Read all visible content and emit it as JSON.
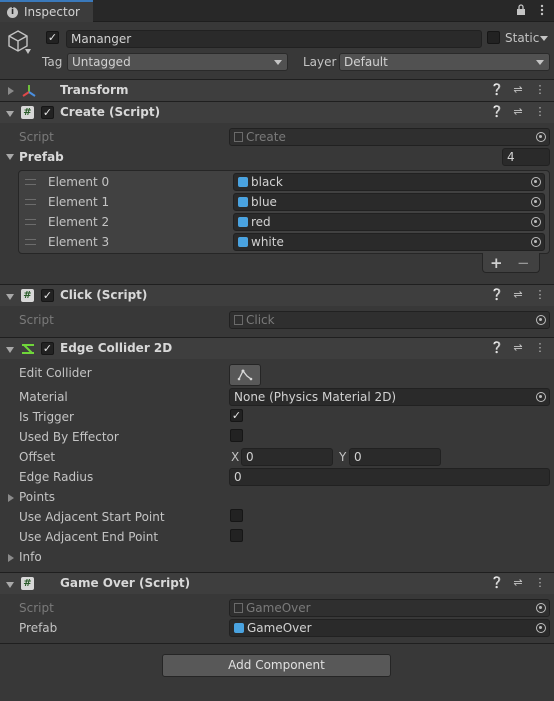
{
  "window": {
    "tab_label": "Inspector"
  },
  "gameobject": {
    "name": "Mananger",
    "static_label": "Static",
    "tag_label": "Tag",
    "tag_value": "Untagged",
    "layer_label": "Layer",
    "layer_value": "Default"
  },
  "components": {
    "transform": {
      "title": "Transform"
    },
    "create": {
      "title": "Create (Script)",
      "script_label": "Script",
      "script_value": "Create",
      "prefab_label": "Prefab",
      "prefab_size": "4",
      "elements": [
        {
          "label": "Element 0",
          "value": "black"
        },
        {
          "label": "Element 1",
          "value": "blue"
        },
        {
          "label": "Element 2",
          "value": "red"
        },
        {
          "label": "Element 3",
          "value": "white"
        }
      ],
      "add_symbol": "+",
      "remove_symbol": "−"
    },
    "click": {
      "title": "Click (Script)",
      "script_label": "Script",
      "script_value": "Click"
    },
    "edge": {
      "title": "Edge Collider 2D",
      "edit_collider_label": "Edit Collider",
      "material_label": "Material",
      "material_value": "None (Physics Material 2D)",
      "is_trigger_label": "Is Trigger",
      "used_by_effector_label": "Used By Effector",
      "offset_label": "Offset",
      "offset_x_label": "X",
      "offset_x": "0",
      "offset_y_label": "Y",
      "offset_y": "0",
      "edge_radius_label": "Edge Radius",
      "edge_radius": "0",
      "points_label": "Points",
      "adj_start_label": "Use Adjacent Start Point",
      "adj_end_label": "Use Adjacent End Point",
      "info_label": "Info"
    },
    "gameover": {
      "title": "Game Over (Script)",
      "script_label": "Script",
      "script_value": "GameOver",
      "prefab_label": "Prefab",
      "prefab_value": "GameOver"
    }
  },
  "footer": {
    "add_component_label": "Add Component"
  },
  "icons": {
    "lock": "lock-icon",
    "menu": "kebab-icon",
    "help": "help-icon",
    "settings": "preset-icon"
  },
  "colors": {
    "accent": "#3a79bb",
    "background": "#383838",
    "header": "#3e3e3e"
  }
}
